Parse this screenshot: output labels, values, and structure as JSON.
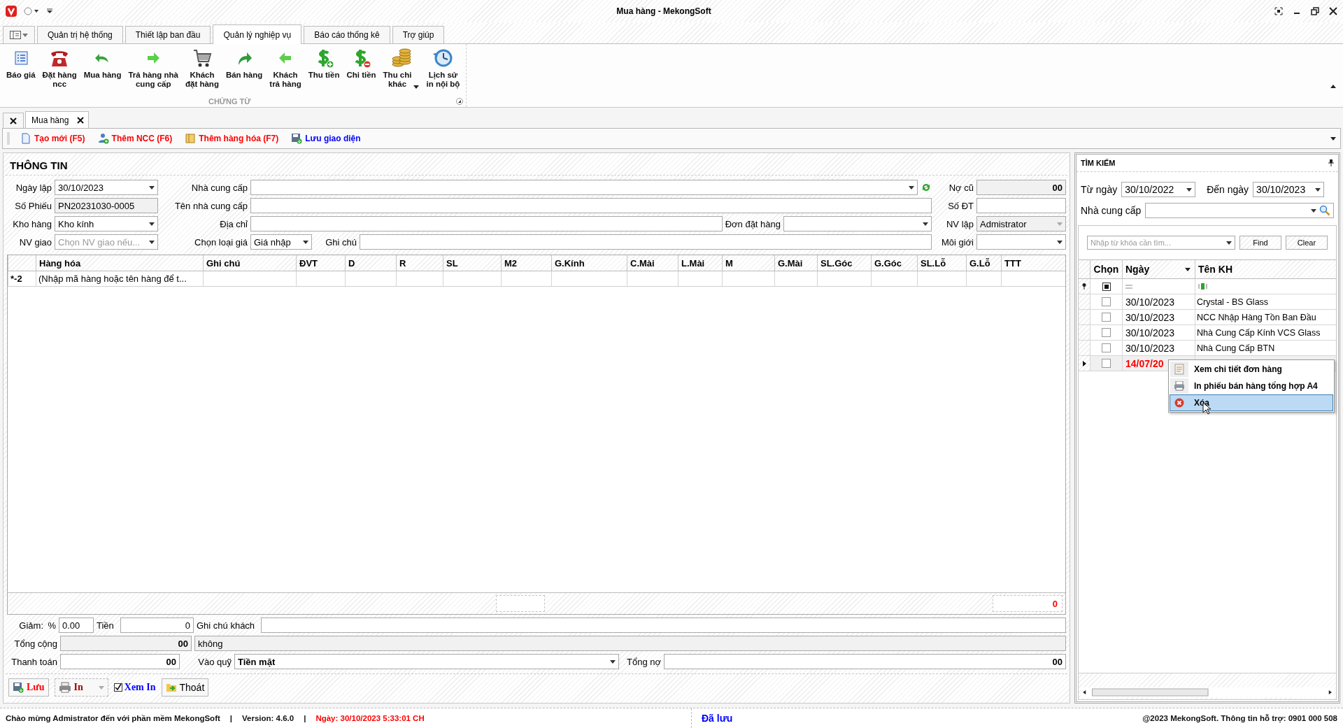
{
  "window": {
    "title": "Mua hàng - MekongSoft"
  },
  "ribbon_tabs": [
    {
      "label": "Quản trị hệ thống",
      "selected": false
    },
    {
      "label": "Thiết lập ban đầu",
      "selected": false
    },
    {
      "label": "Quản lý nghiệp vụ",
      "selected": true
    },
    {
      "label": "Báo cáo thống kê",
      "selected": false
    },
    {
      "label": "Trợ giúp",
      "selected": false
    }
  ],
  "ribbon_group": {
    "title": "CHỨNG TỪ",
    "buttons": [
      {
        "label": "Báo giá",
        "has_menu": false
      },
      {
        "label": "Đặt hàng\nncc",
        "has_menu": false
      },
      {
        "label": "Mua hàng",
        "has_menu": false
      },
      {
        "label": "Trả hàng nhà\ncung cấp",
        "has_menu": false
      },
      {
        "label": "Khách\nđặt hàng",
        "has_menu": false
      },
      {
        "label": "Bán hàng",
        "has_menu": false
      },
      {
        "label": "Khách\ntrả hàng",
        "has_menu": false
      },
      {
        "label": "Thu tiền",
        "has_menu": false
      },
      {
        "label": "Chi tiền",
        "has_menu": false
      },
      {
        "label": "Thu chi\nkhác",
        "has_menu": true
      },
      {
        "label": "Lịch sử\nin nội bộ",
        "has_menu": false
      }
    ]
  },
  "doc_tabs": [
    {
      "label": "Mua hàng",
      "selected": true
    }
  ],
  "toolbar": [
    {
      "label": "Tạo mới (F5)",
      "color": "#ff0000"
    },
    {
      "label": "Thêm NCC (F6)",
      "color": "#ff0000"
    },
    {
      "label": "Thêm hàng hóa (F7)",
      "color": "#ff0000"
    },
    {
      "label": "Lưu giao diện",
      "color": "#0000ff"
    }
  ],
  "info": {
    "title": "THÔNG TIN",
    "ngay_lap": {
      "label": "Ngày lập",
      "value": "30/10/2023"
    },
    "so_phieu": {
      "label": "Số Phiếu",
      "value": "PN20231030-0005",
      "disabled": true
    },
    "kho_hang": {
      "label": "Kho hàng",
      "value": "Kho kính"
    },
    "nv_giao": {
      "label": "NV giao",
      "placeholder": "Chọn NV giao nếu..."
    },
    "nha_cung_cap": {
      "label": "Nhà cung cấp"
    },
    "ten_nha_cung_cap": {
      "label": "Tên nhà cung cấp"
    },
    "dia_chi": {
      "label": "Địa chỉ"
    },
    "don_dat_hang": {
      "label": "Đơn đặt hàng"
    },
    "chon_loai_gia": {
      "label": "Chọn loại giá",
      "value": "Giá nhập"
    },
    "ghi_chu": {
      "label": "Ghi chú"
    },
    "no_cu": {
      "label": "Nợ cũ",
      "value": "00",
      "disabled": true
    },
    "so_dt": {
      "label": "Số ĐT"
    },
    "nv_lap": {
      "label": "NV lập",
      "value": "Admistrator",
      "disabled": true
    },
    "moi_gioi": {
      "label": "Môi giới"
    }
  },
  "items_table": {
    "columns": [
      "Hàng hóa",
      "Ghi chú",
      "ĐVT",
      "D",
      "R",
      "SL",
      "M2",
      "G.Kính",
      "C.Mài",
      "L.Mài",
      "M",
      "G.Mài",
      "SL.Góc",
      "G.Góc",
      "SL.Lỗ",
      "G.Lỗ",
      "TTT"
    ],
    "new_row": {
      "marker": "*-2",
      "hint": "(Nhập mã hàng hoặc tên hàng để t..."
    },
    "footer_total": "0"
  },
  "summary": {
    "discount_label": "Giảm:",
    "percent_label": "%",
    "percent": "0.00",
    "amount_label": "Tiền",
    "amount": "0",
    "customer_note_label": "Ghi chú khách",
    "total_label": "Tổng cộng",
    "total": "00",
    "total_words": "không",
    "payment_label": "Thanh toán",
    "payment": "00",
    "fund_label": "Vào quỹ",
    "fund": "Tiền mặt",
    "debt_label": "Tổng nợ",
    "debt": "00"
  },
  "actions": [
    {
      "kind": "button",
      "label": "Lưu",
      "color": "#ff0000"
    },
    {
      "kind": "split",
      "label": "In",
      "color": "#a00000"
    },
    {
      "kind": "checkbox",
      "label": "Xem In",
      "color": "#0000ff",
      "checked": true
    },
    {
      "kind": "button",
      "label": "Thoát",
      "color": "#000000"
    }
  ],
  "search": {
    "title": "TÌM KIẾM",
    "from_label": "Từ ngày",
    "from": "30/10/2022",
    "to_label": "Đến ngày",
    "to": "30/10/2023",
    "supplier_label": "Nhà cung cấp",
    "keyword_placeholder": "Nhập từ khóa cần tìm...",
    "buttons": [
      "Find",
      "Clear"
    ],
    "columns": [
      "Chọn",
      "Ngày",
      "Tên KH"
    ],
    "rows": [
      {
        "checked": false,
        "selected": false,
        "date": "30/10/2023",
        "name": "Crystal - BS Glass",
        "color": "#000000"
      },
      {
        "checked": false,
        "selected": false,
        "date": "30/10/2023",
        "name": "NCC Nhập Hàng Tồn Ban Đầu",
        "color": "#000000"
      },
      {
        "checked": false,
        "selected": false,
        "date": "30/10/2023",
        "name": "Nhà Cung Cấp Kính VCS Glass",
        "color": "#000000"
      },
      {
        "checked": false,
        "selected": false,
        "date": "30/10/2023",
        "name": "Nhà Cung Cấp BTN",
        "color": "#000000"
      },
      {
        "checked": false,
        "selected": true,
        "date": "14/07/20",
        "color": "#ff0000"
      }
    ]
  },
  "context_menu": [
    {
      "label": "Xem chi tiết đơn hàng",
      "selected": false
    },
    {
      "label": "In phiếu bán hàng tổng hợp A4",
      "selected": false
    },
    {
      "label": "Xóa",
      "selected": true
    }
  ],
  "status_bar": {
    "welcome": "Chào mừng Admistrator đến với phần mềm MekongSoft",
    "separator": "|",
    "version": "Version: 4.6.0",
    "date": "Ngày: 30/10/2023 5:33:01 CH",
    "saved": "Đã lưu",
    "support": "@2023 MekongSoft. Thông tin hỗ trợ: 0901 000 508"
  }
}
